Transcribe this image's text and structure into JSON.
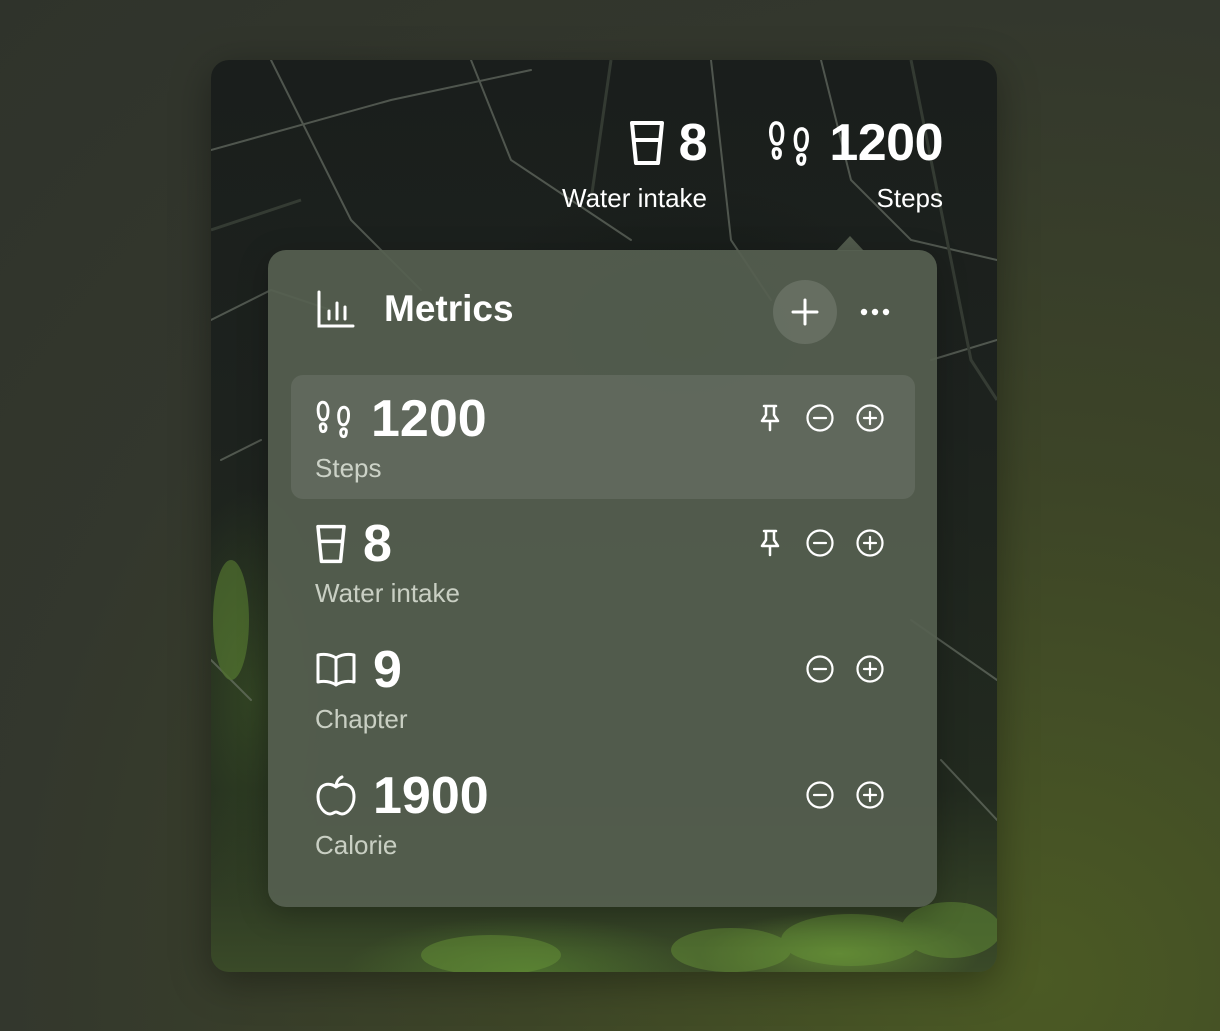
{
  "summary": {
    "water": {
      "icon": "cup-icon",
      "value": "8",
      "label": "Water intake"
    },
    "steps": {
      "icon": "footprints-icon",
      "value": "1200",
      "label": "Steps"
    }
  },
  "popover": {
    "title": "Metrics",
    "icon": "bar-chart-icon",
    "add_icon": "plus-icon",
    "more_icon": "ellipsis-icon"
  },
  "metrics": [
    {
      "icon": "footprints-icon",
      "value": "1200",
      "label": "Steps",
      "pinned_action": true
    },
    {
      "icon": "cup-icon",
      "value": "8",
      "label": "Water intake",
      "pinned_action": true
    },
    {
      "icon": "book-icon",
      "value": "9",
      "label": "Chapter",
      "pinned_action": false
    },
    {
      "icon": "apple-icon",
      "value": "1900",
      "label": "Calorie",
      "pinned_action": false
    }
  ],
  "colors": {
    "popover_bg": "#566050",
    "text": "#ffffff",
    "secondary_text": "#e6ebe0"
  }
}
